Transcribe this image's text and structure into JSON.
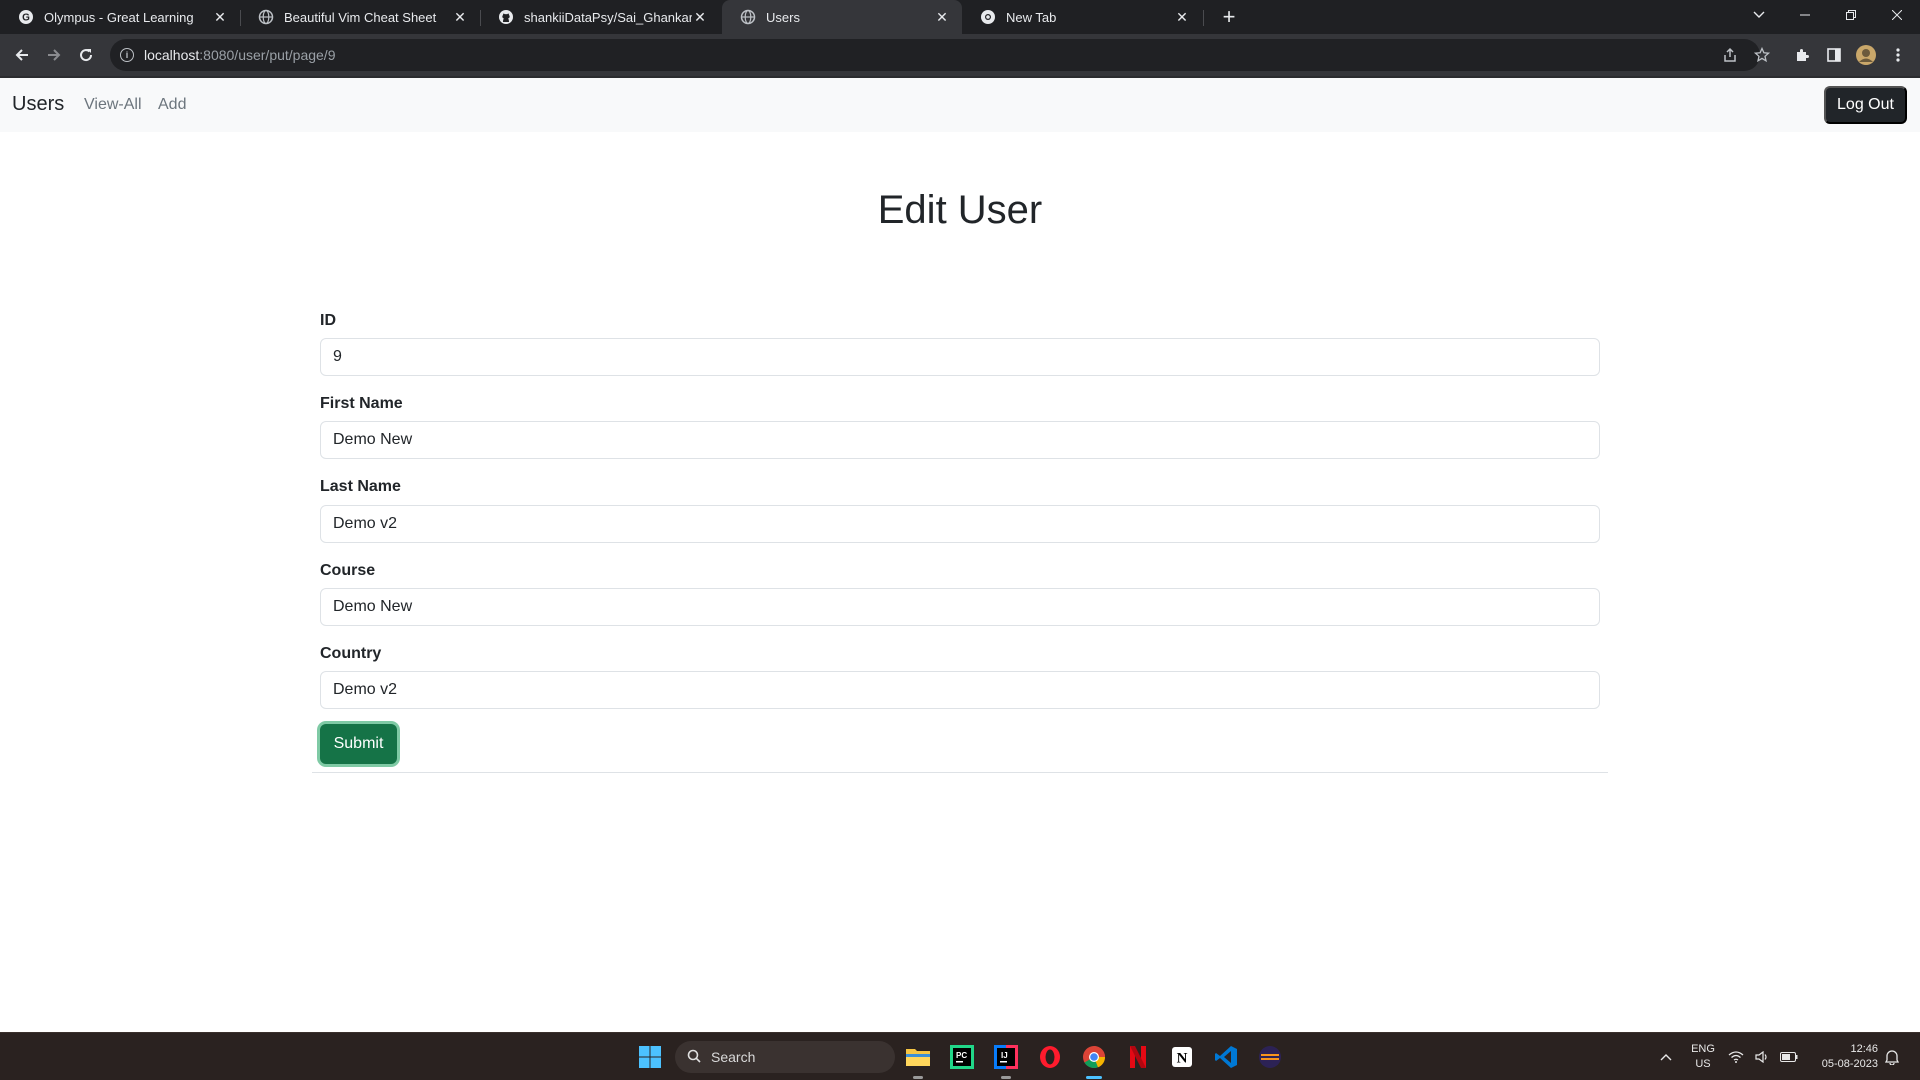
{
  "browser": {
    "tabs": [
      {
        "title": "Olympus - Great Learning",
        "icon": "google-g-icon",
        "active": false
      },
      {
        "title": "Beautiful Vim Cheat Sheet",
        "icon": "globe-icon",
        "active": false
      },
      {
        "title": "shankiiDataPsy/Sai_Ghankar_G_B",
        "icon": "github-icon",
        "active": false
      },
      {
        "title": "Users",
        "icon": "globe-icon",
        "active": true
      },
      {
        "title": "New Tab",
        "icon": "chrome-icon",
        "active": false
      }
    ],
    "url_host": "localhost",
    "url_rest": ":8080/user/put/page/9"
  },
  "navbar": {
    "brand": "Users",
    "links": [
      "View-All",
      "Add"
    ],
    "logout_label": "Log Out"
  },
  "page": {
    "title": "Edit User",
    "fields": [
      {
        "label": "ID",
        "value": "9"
      },
      {
        "label": "First Name",
        "value": "Demo New"
      },
      {
        "label": "Last Name",
        "value": "Demo v2"
      },
      {
        "label": "Course",
        "value": "Demo New"
      },
      {
        "label": "Country",
        "value": "Demo v2"
      }
    ],
    "submit_label": "Submit"
  },
  "taskbar": {
    "search_placeholder": "Search",
    "lang_top": "ENG",
    "lang_bottom": "US",
    "time": "12:46",
    "date": "05-08-2023"
  },
  "colors": {
    "submit": "#157347",
    "logout": "#212529",
    "navbar_bg": "#f8f9fa"
  }
}
